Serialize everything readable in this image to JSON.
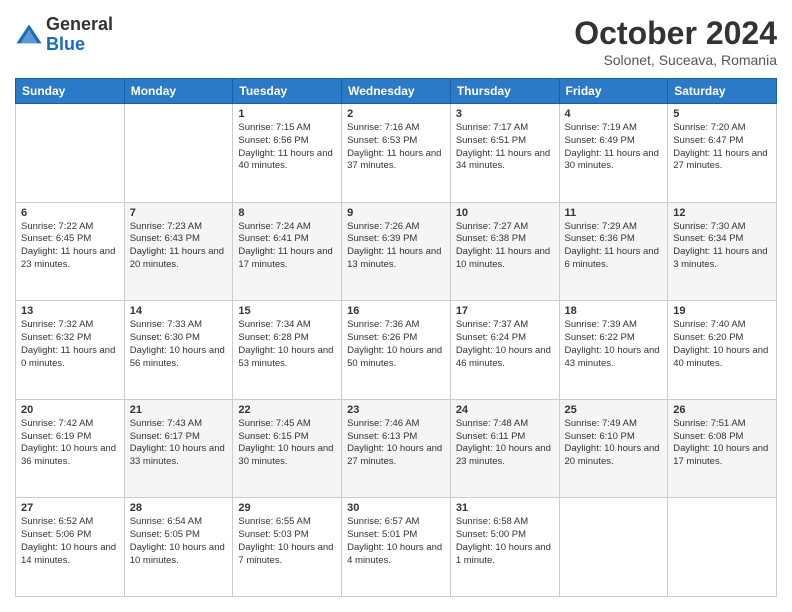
{
  "logo": {
    "general": "General",
    "blue": "Blue"
  },
  "title": "October 2024",
  "subtitle": "Solonet, Suceava, Romania",
  "days_of_week": [
    "Sunday",
    "Monday",
    "Tuesday",
    "Wednesday",
    "Thursday",
    "Friday",
    "Saturday"
  ],
  "weeks": [
    [
      {
        "day": "",
        "info": ""
      },
      {
        "day": "",
        "info": ""
      },
      {
        "day": "1",
        "info": "Sunrise: 7:15 AM\nSunset: 6:56 PM\nDaylight: 11 hours and 40 minutes."
      },
      {
        "day": "2",
        "info": "Sunrise: 7:16 AM\nSunset: 6:53 PM\nDaylight: 11 hours and 37 minutes."
      },
      {
        "day": "3",
        "info": "Sunrise: 7:17 AM\nSunset: 6:51 PM\nDaylight: 11 hours and 34 minutes."
      },
      {
        "day": "4",
        "info": "Sunrise: 7:19 AM\nSunset: 6:49 PM\nDaylight: 11 hours and 30 minutes."
      },
      {
        "day": "5",
        "info": "Sunrise: 7:20 AM\nSunset: 6:47 PM\nDaylight: 11 hours and 27 minutes."
      }
    ],
    [
      {
        "day": "6",
        "info": "Sunrise: 7:22 AM\nSunset: 6:45 PM\nDaylight: 11 hours and 23 minutes."
      },
      {
        "day": "7",
        "info": "Sunrise: 7:23 AM\nSunset: 6:43 PM\nDaylight: 11 hours and 20 minutes."
      },
      {
        "day": "8",
        "info": "Sunrise: 7:24 AM\nSunset: 6:41 PM\nDaylight: 11 hours and 17 minutes."
      },
      {
        "day": "9",
        "info": "Sunrise: 7:26 AM\nSunset: 6:39 PM\nDaylight: 11 hours and 13 minutes."
      },
      {
        "day": "10",
        "info": "Sunrise: 7:27 AM\nSunset: 6:38 PM\nDaylight: 11 hours and 10 minutes."
      },
      {
        "day": "11",
        "info": "Sunrise: 7:29 AM\nSunset: 6:36 PM\nDaylight: 11 hours and 6 minutes."
      },
      {
        "day": "12",
        "info": "Sunrise: 7:30 AM\nSunset: 6:34 PM\nDaylight: 11 hours and 3 minutes."
      }
    ],
    [
      {
        "day": "13",
        "info": "Sunrise: 7:32 AM\nSunset: 6:32 PM\nDaylight: 11 hours and 0 minutes."
      },
      {
        "day": "14",
        "info": "Sunrise: 7:33 AM\nSunset: 6:30 PM\nDaylight: 10 hours and 56 minutes."
      },
      {
        "day": "15",
        "info": "Sunrise: 7:34 AM\nSunset: 6:28 PM\nDaylight: 10 hours and 53 minutes."
      },
      {
        "day": "16",
        "info": "Sunrise: 7:36 AM\nSunset: 6:26 PM\nDaylight: 10 hours and 50 minutes."
      },
      {
        "day": "17",
        "info": "Sunrise: 7:37 AM\nSunset: 6:24 PM\nDaylight: 10 hours and 46 minutes."
      },
      {
        "day": "18",
        "info": "Sunrise: 7:39 AM\nSunset: 6:22 PM\nDaylight: 10 hours and 43 minutes."
      },
      {
        "day": "19",
        "info": "Sunrise: 7:40 AM\nSunset: 6:20 PM\nDaylight: 10 hours and 40 minutes."
      }
    ],
    [
      {
        "day": "20",
        "info": "Sunrise: 7:42 AM\nSunset: 6:19 PM\nDaylight: 10 hours and 36 minutes."
      },
      {
        "day": "21",
        "info": "Sunrise: 7:43 AM\nSunset: 6:17 PM\nDaylight: 10 hours and 33 minutes."
      },
      {
        "day": "22",
        "info": "Sunrise: 7:45 AM\nSunset: 6:15 PM\nDaylight: 10 hours and 30 minutes."
      },
      {
        "day": "23",
        "info": "Sunrise: 7:46 AM\nSunset: 6:13 PM\nDaylight: 10 hours and 27 minutes."
      },
      {
        "day": "24",
        "info": "Sunrise: 7:48 AM\nSunset: 6:11 PM\nDaylight: 10 hours and 23 minutes."
      },
      {
        "day": "25",
        "info": "Sunrise: 7:49 AM\nSunset: 6:10 PM\nDaylight: 10 hours and 20 minutes."
      },
      {
        "day": "26",
        "info": "Sunrise: 7:51 AM\nSunset: 6:08 PM\nDaylight: 10 hours and 17 minutes."
      }
    ],
    [
      {
        "day": "27",
        "info": "Sunrise: 6:52 AM\nSunset: 5:06 PM\nDaylight: 10 hours and 14 minutes."
      },
      {
        "day": "28",
        "info": "Sunrise: 6:54 AM\nSunset: 5:05 PM\nDaylight: 10 hours and 10 minutes."
      },
      {
        "day": "29",
        "info": "Sunrise: 6:55 AM\nSunset: 5:03 PM\nDaylight: 10 hours and 7 minutes."
      },
      {
        "day": "30",
        "info": "Sunrise: 6:57 AM\nSunset: 5:01 PM\nDaylight: 10 hours and 4 minutes."
      },
      {
        "day": "31",
        "info": "Sunrise: 6:58 AM\nSunset: 5:00 PM\nDaylight: 10 hours and 1 minute."
      },
      {
        "day": "",
        "info": ""
      },
      {
        "day": "",
        "info": ""
      }
    ]
  ]
}
